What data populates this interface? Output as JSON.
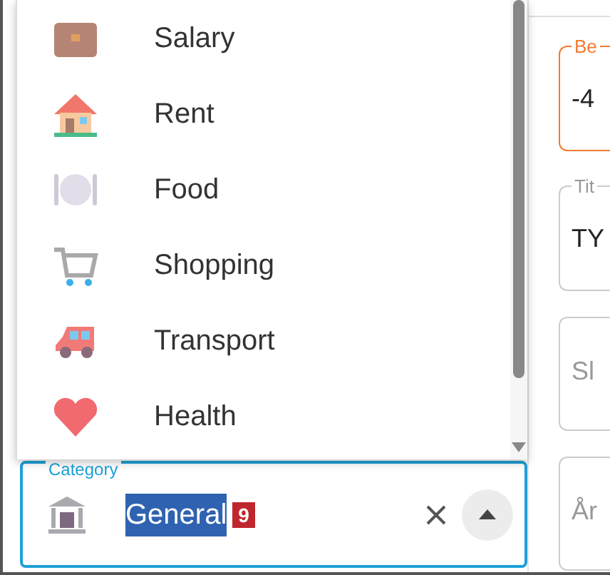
{
  "category_menu": {
    "items": [
      {
        "label": "Salary",
        "kind": "briefcase"
      },
      {
        "label": "Rent",
        "kind": "house"
      },
      {
        "label": "Food",
        "kind": "plate"
      },
      {
        "label": "Shopping",
        "kind": "cart"
      },
      {
        "label": "Transport",
        "kind": "car"
      },
      {
        "label": "Health",
        "kind": "heart"
      }
    ]
  },
  "category_field": {
    "label": "Category",
    "value": "General",
    "badge": "9"
  },
  "side_form": {
    "fields": [
      {
        "label": "Be",
        "value": "-4",
        "focused": true
      },
      {
        "label": "Tit",
        "value": "TY",
        "focused": false
      },
      {
        "placeholder": "Sl",
        "focused": false
      },
      {
        "placeholder": "År",
        "focused": false
      }
    ]
  }
}
